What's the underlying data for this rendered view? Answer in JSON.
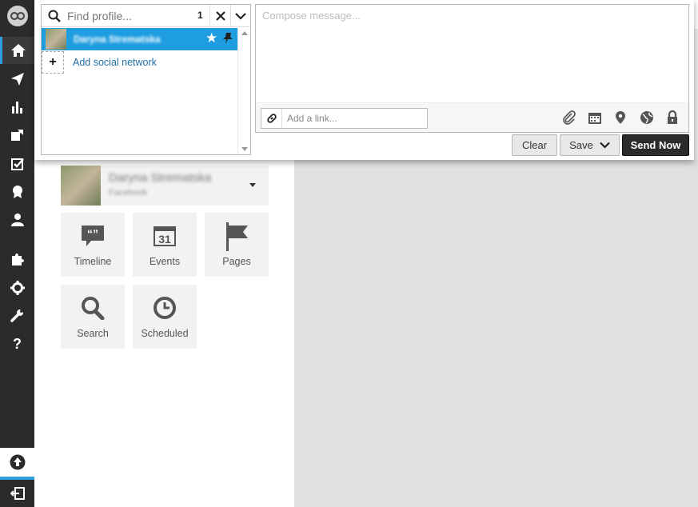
{
  "composer": {
    "search_placeholder": "Find profile...",
    "selected_count": "1",
    "selected_profile": {
      "name": "Daryna Strematska",
      "starred": true
    },
    "add_network_label": "Add social network",
    "message_placeholder": "Compose message...",
    "link_placeholder": "Add a link...",
    "buttons": {
      "clear": "Clear",
      "save": "Save",
      "send": "Send Now"
    },
    "toolbar_icons": [
      "paperclip-icon",
      "calendar-icon",
      "location-pin-icon",
      "globe-icon",
      "lock-icon"
    ]
  },
  "profile": {
    "name": "Daryna Strematska",
    "network": "Facebook"
  },
  "tiles": [
    {
      "label": "Timeline",
      "icon": "quote-bubble-icon"
    },
    {
      "label": "Events",
      "icon": "calendar-31-icon",
      "badge": "31"
    },
    {
      "label": "Pages",
      "icon": "flag-icon"
    },
    {
      "label": "Search",
      "icon": "magnifier-icon"
    },
    {
      "label": "Scheduled",
      "icon": "clock-icon"
    }
  ],
  "nav": {
    "items": [
      "home-icon",
      "paper-plane-icon",
      "bar-chart-icon",
      "assignments-icon",
      "checkbox-icon",
      "ribbon-icon",
      "user-icon",
      "puzzle-icon",
      "gear-icon",
      "wrench-icon",
      "help-icon"
    ],
    "help_glyph": "?",
    "accent": "#2d9fe0"
  }
}
